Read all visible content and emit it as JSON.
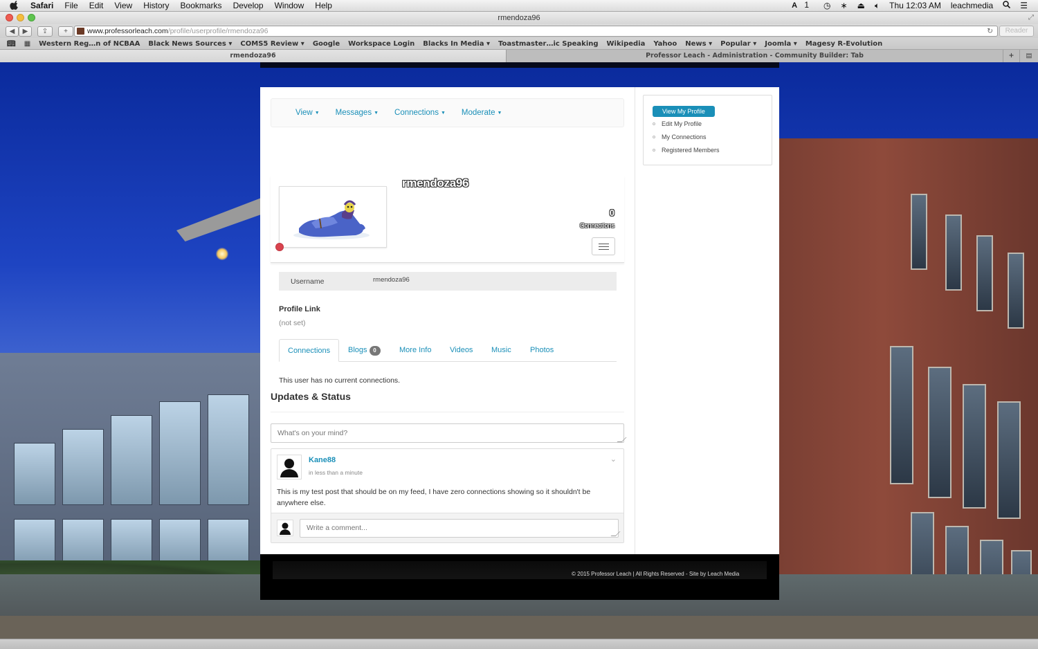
{
  "menubar": {
    "app": "Safari",
    "items": [
      "File",
      "Edit",
      "View",
      "History",
      "Bookmarks",
      "Develop",
      "Window",
      "Help"
    ],
    "right": {
      "input_indicator": "1",
      "clock": "Thu 12:03 AM",
      "user": "leachmedia"
    }
  },
  "window": {
    "title": "rmendoza96"
  },
  "addressbar": {
    "domain": "www.professorleach.com",
    "path": "/profile/userprofile/rmendoza96",
    "reader_label": "Reader"
  },
  "bookmarks": [
    {
      "label": "Western Reg…n of NCBAA",
      "has_menu": false
    },
    {
      "label": "Black News Sources",
      "has_menu": true
    },
    {
      "label": "COMS5 Review",
      "has_menu": true
    },
    {
      "label": "Google",
      "has_menu": false
    },
    {
      "label": "Workspace Login",
      "has_menu": false
    },
    {
      "label": "Blacks In Media",
      "has_menu": true
    },
    {
      "label": "Toastmaster…ic Speaking",
      "has_menu": false
    },
    {
      "label": "Wikipedia",
      "has_menu": false
    },
    {
      "label": "Yahoo",
      "has_menu": false
    },
    {
      "label": "News",
      "has_menu": true
    },
    {
      "label": "Popular",
      "has_menu": true
    },
    {
      "label": "Joomla",
      "has_menu": true
    },
    {
      "label": "Magesy R-Evolution",
      "has_menu": false
    }
  ],
  "tabs": [
    {
      "label": "rmendoza96",
      "active": true
    },
    {
      "label": "Professor Leach - Administration - Community Builder: Tab",
      "active": false
    }
  ],
  "main_nav": [
    "View",
    "Messages",
    "Connections",
    "Moderate"
  ],
  "profile": {
    "name": "rmendoza96",
    "connections_count": "0",
    "connections_label": "Connections",
    "online_status_color": "#d9434e"
  },
  "fields": {
    "username_label": "Username",
    "username_value": "rmendoza96",
    "profile_link_label": "Profile Link",
    "profile_link_value": "(not set)"
  },
  "profile_tabs": [
    {
      "label": "Connections",
      "active": true
    },
    {
      "label": "Blogs",
      "badge": "0"
    },
    {
      "label": "More Info"
    },
    {
      "label": "Videos"
    },
    {
      "label": "Music"
    },
    {
      "label": "Photos"
    }
  ],
  "connections_empty": "This user has no current connections.",
  "updates": {
    "title": "Updates & Status",
    "placeholder": "What's on your mind?"
  },
  "post": {
    "author": "Kane88",
    "time": "in less than a minute",
    "body": "This is my test post that should be on my feed, I have zero connections showing so it shouldn't be anywhere else.",
    "comment_placeholder": "Write a comment..."
  },
  "sidebar": {
    "items": [
      {
        "label": "View My Profile",
        "active": true
      },
      {
        "label": "Edit My Profile"
      },
      {
        "label": "My Connections"
      },
      {
        "label": "Registered Members"
      }
    ]
  },
  "footer": {
    "text": "© 2015 Professor Leach | All Rights Reserved - Site by Leach Media"
  },
  "colors": {
    "accent": "#1a8fb8",
    "sky": "#1e44c2"
  }
}
